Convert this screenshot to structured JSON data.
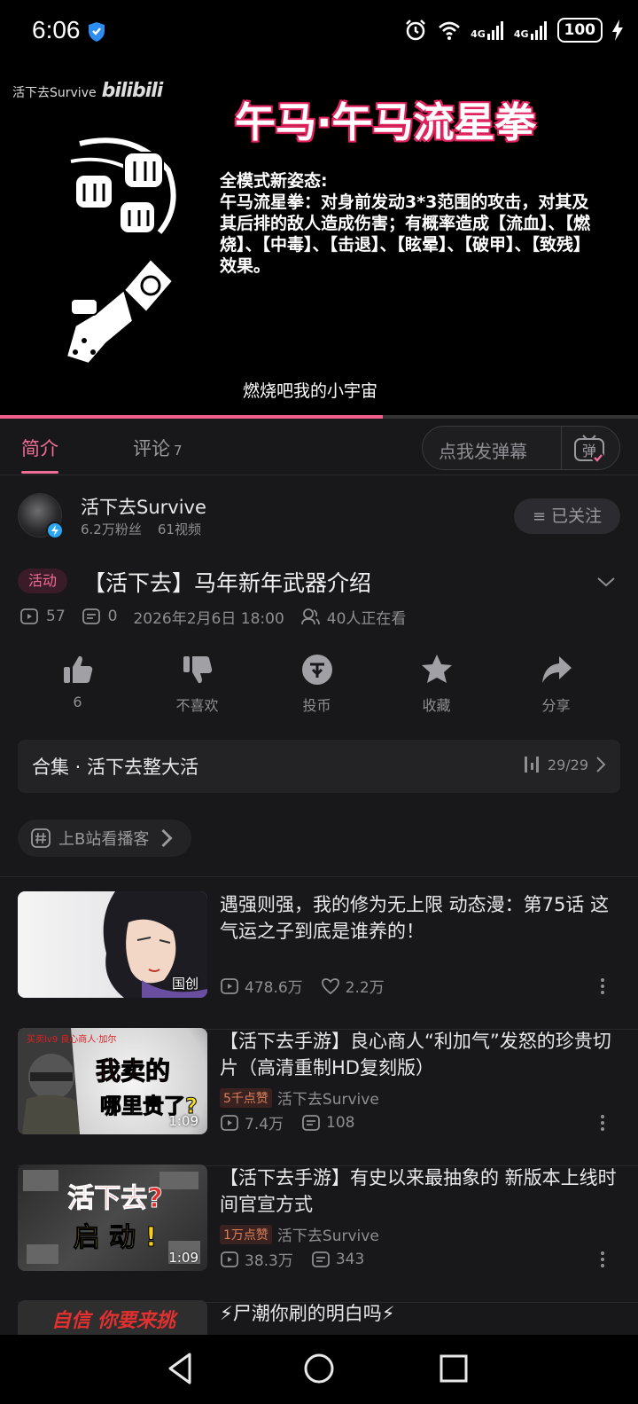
{
  "status_bar": {
    "time": "6:06",
    "net1": "4G",
    "net2": "4G",
    "battery": "100"
  },
  "video": {
    "watermark": "活下去Survive",
    "watermark_logo": "bilibili",
    "title": "午马·午马流星拳",
    "description": "全模式新姿态:\n午马流星拳：对身前发动3*3范围的攻击，对其及其后排的敌人造成伤害；有概率造成【流血】、【燃烧】、【中毒】、【击退】、【眩晕】、【破甲】、【致残】效果。",
    "subtitle": "燃烧吧我的小宇宙",
    "progress": 0.6
  },
  "tabs": {
    "intro": "简介",
    "comments": "评论",
    "comments_count": "7",
    "danmaku_placeholder": "点我发弹幕",
    "danmaku_btn": "弹"
  },
  "uploader": {
    "name": "活下去Survive",
    "fans": "6.2万粉丝",
    "videos": "61视频",
    "follow_label": "已关注"
  },
  "video_info": {
    "tag": "活动",
    "title": "【活下去】马年新年武器介绍",
    "views": "57",
    "danmaku": "0",
    "date": "2026年2月6日 18:00",
    "watching": "40人正在看"
  },
  "actions": {
    "like": "6",
    "dislike": "不喜欢",
    "coin": "投币",
    "favorite": "收藏",
    "share": "分享"
  },
  "collection": {
    "title": "合集 · 活下去整大活",
    "progress": "29/29"
  },
  "hashtag": {
    "label": "上B站看播客"
  },
  "recommendations": [
    {
      "title": "遇强则强，我的修为无上限 动态漫：第75话 这气运之子到底是谁养的！",
      "badge": "国创",
      "views": "478.6万",
      "likes": "2.2万"
    },
    {
      "title": "【活下去手游】良心商人“利加气”发怒的珍贵切片（高清重制HD复刻版）",
      "badge": "1:09",
      "hot": "5千点赞",
      "up": "活下去Survive",
      "views": "7.4万",
      "danmaku": "108",
      "thumb_text1": "我卖的",
      "thumb_text2": "哪里贵了?",
      "thumb_caption": "买卖lv9 良心商人·加尔"
    },
    {
      "title": "【活下去手游】有史以来最抽象的 新版本上线时间官宣方式",
      "badge": "1:09",
      "hot": "1万点赞",
      "up": "活下去Survive",
      "views": "38.3万",
      "danmaku": "343",
      "thumb_text1": "活下去?",
      "thumb_text2": "启 动 !"
    },
    {
      "title": "⚡尸潮你刷的明白吗⚡",
      "thumb_text1": "自信 你要来挑"
    }
  ],
  "colors": {
    "accent": "#f06d96",
    "panel_bg": "#18181a",
    "card_bg": "#232326"
  }
}
